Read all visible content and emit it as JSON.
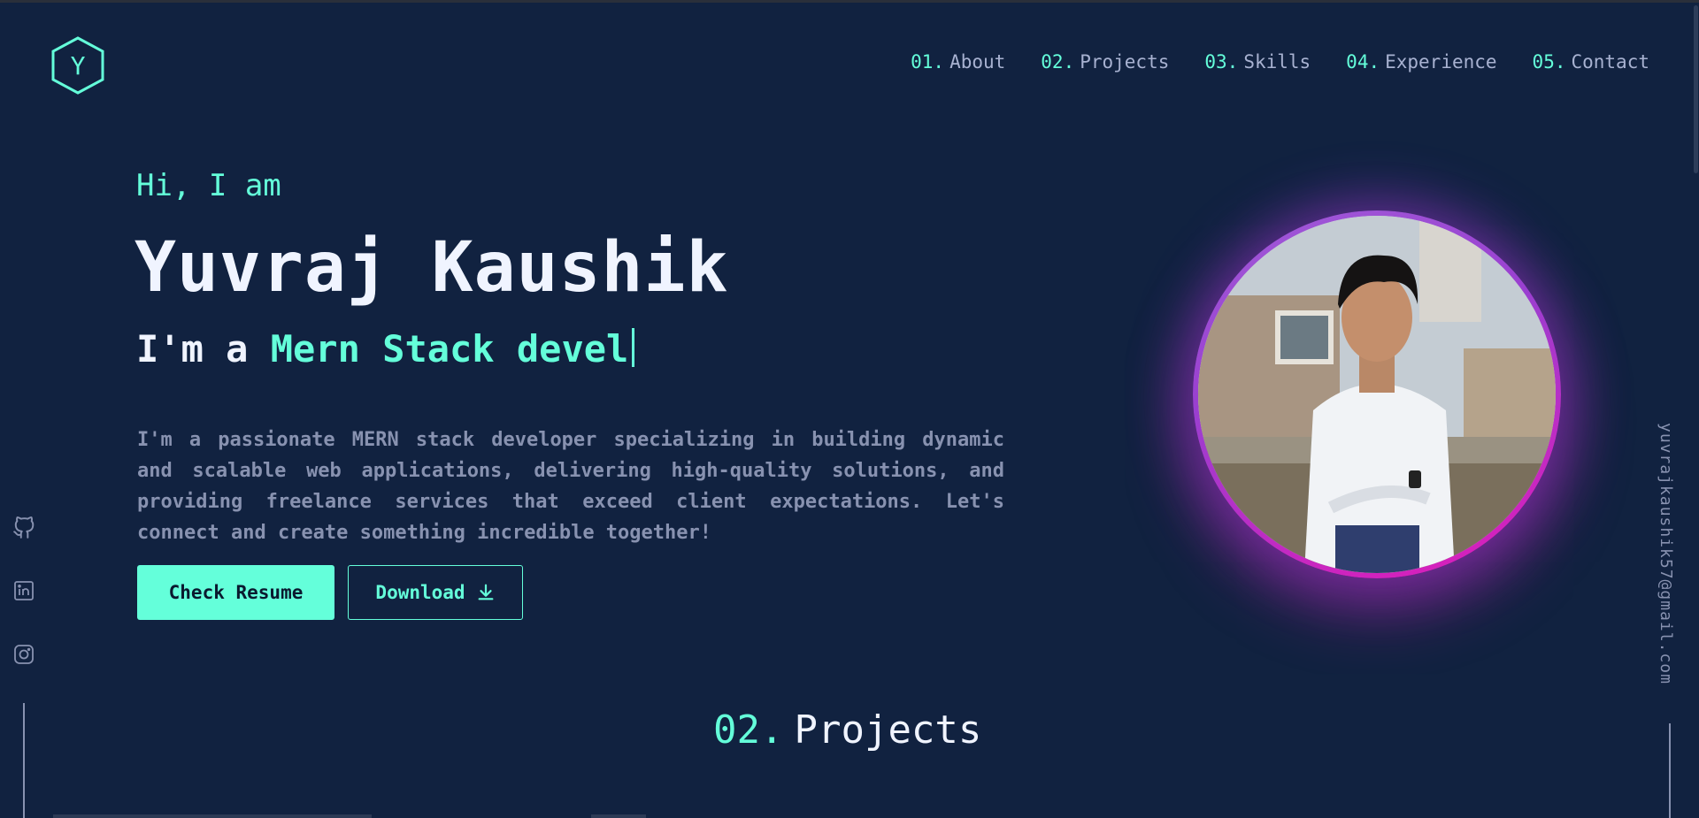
{
  "logo": {
    "letter": "Y",
    "icon": "hexagon-logo-icon"
  },
  "nav": [
    {
      "num": "01.",
      "label": "About"
    },
    {
      "num": "02.",
      "label": "Projects"
    },
    {
      "num": "03.",
      "label": "Skills"
    },
    {
      "num": "04.",
      "label": "Experience"
    },
    {
      "num": "05.",
      "label": "Contact"
    }
  ],
  "hero": {
    "greeting": "Hi, I am",
    "name": "Yuvraj Kaushik",
    "role_prefix": "I'm a",
    "role_typed": "Mern Stack devel",
    "bio": "I'm a passionate MERN stack developer specializing in building dynamic and scalable web applications, delivering high-quality solutions, and providing freelance services that exceed client expectations. Let's connect and create something incredible together!",
    "resume_button": "Check Resume",
    "download_button": "Download"
  },
  "social": [
    "github-icon",
    "linkedin-icon",
    "instagram-icon"
  ],
  "email": "yuvrajkaushik57@gmail.com",
  "section": {
    "num": "02.",
    "title": "Projects"
  },
  "colors": {
    "background": "#112240",
    "accent": "#64ffda",
    "text": "#ccd6f6",
    "muted": "#8892b0"
  }
}
